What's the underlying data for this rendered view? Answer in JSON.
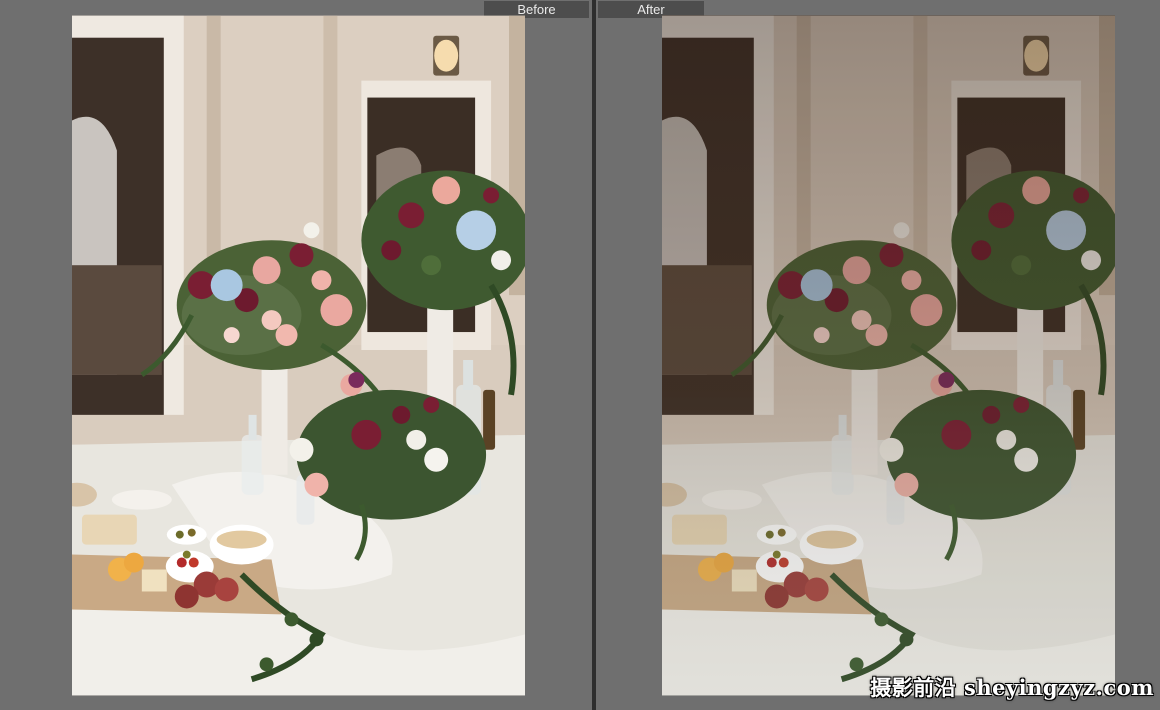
{
  "comparison": {
    "before": {
      "label": "Before",
      "description": "Original photo: wedding reception table with floral centerpieces, charcuterie board and glass bottles on a veranda"
    },
    "after": {
      "label": "After",
      "description": "Edited photo with moody, warm, faded color grade"
    }
  },
  "watermark": {
    "text": "摄影前沿 sheyingzyz.com"
  },
  "colors": {
    "background": "#6f6f6f",
    "label_bg": "#4d4d4d",
    "divider": "#2e2e2e"
  }
}
